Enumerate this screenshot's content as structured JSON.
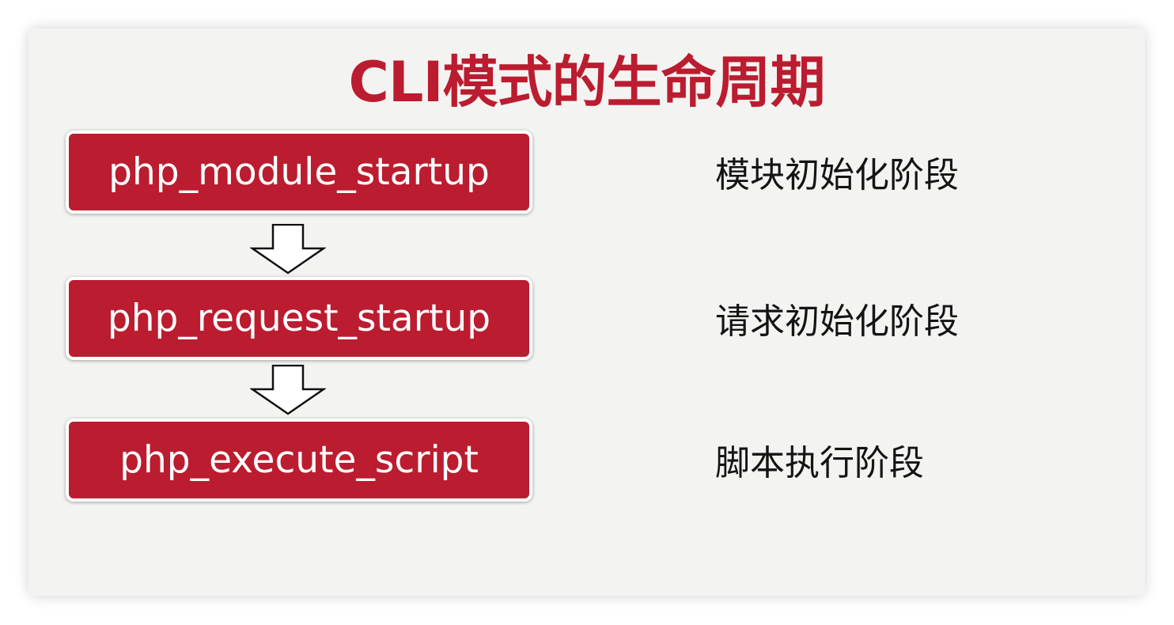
{
  "title": "CLI模式的生命周期",
  "colors": {
    "accent": "#bb1c2f",
    "text": "#141414",
    "slide_bg": "#f3f4f2"
  },
  "stages": [
    {
      "label": "php_module_startup",
      "description": "模块初始化阶段"
    },
    {
      "label": "php_request_startup",
      "description": "请求初始化阶段"
    },
    {
      "label": "php_execute_script",
      "description": "脚本执行阶段"
    }
  ],
  "connector_icon": "down-arrow-icon"
}
